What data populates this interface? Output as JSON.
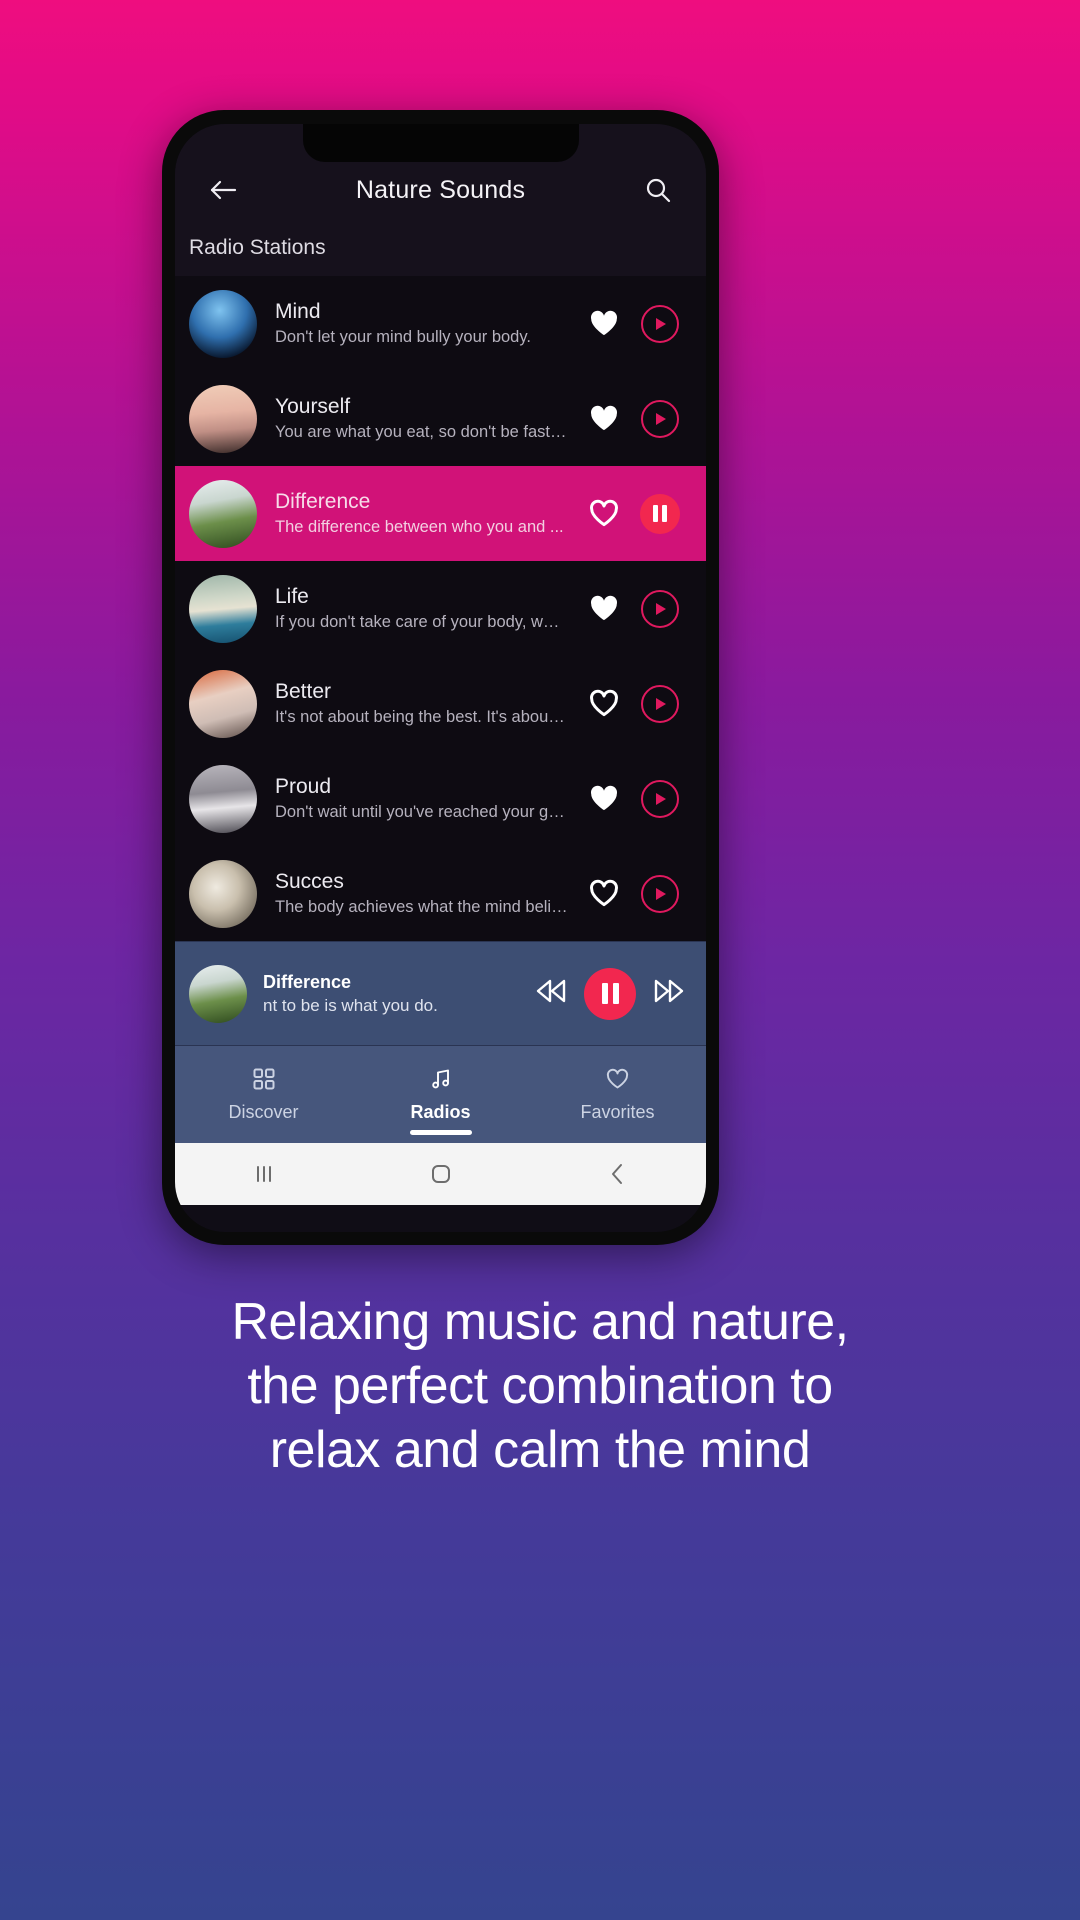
{
  "header": {
    "title": "Nature Sounds",
    "back_icon": "arrow-left-icon",
    "search_icon": "search-icon"
  },
  "section": {
    "label": "Radio Stations"
  },
  "stations": [
    {
      "title": "Mind",
      "subtitle": "Don't let your mind bully your body.",
      "art": "art-mind",
      "favorite": true,
      "playing": false
    },
    {
      "title": "Yourself",
      "subtitle": "You are what you eat, so don't be fast, c...",
      "art": "art-yourself",
      "favorite": true,
      "playing": false
    },
    {
      "title": "Difference",
      "subtitle": "The difference between who you and ...",
      "art": "art-difference",
      "favorite": false,
      "playing": true
    },
    {
      "title": "Life",
      "subtitle": "If you don't take care of your body, whe...",
      "art": "art-life",
      "favorite": true,
      "playing": false
    },
    {
      "title": "Better",
      "subtitle": "It's not about being the best. It's about ...",
      "art": "art-better",
      "favorite": false,
      "playing": false
    },
    {
      "title": "Proud",
      "subtitle": "Don't wait until you've reached your go...",
      "art": "art-proud",
      "favorite": true,
      "playing": false
    },
    {
      "title": "Succes",
      "subtitle": "The body achieves what the mind belie...",
      "art": "art-succes",
      "favorite": false,
      "playing": false
    }
  ],
  "mini_player": {
    "title": "Difference",
    "subtitle": "nt to be is what you do.",
    "art": "art-difference",
    "rewind_icon": "rewind-icon",
    "pause_icon": "pause-icon",
    "forward_icon": "fast-forward-icon"
  },
  "bottom_nav": {
    "items": [
      {
        "label": "Discover",
        "icon": "grid-icon",
        "active": false
      },
      {
        "label": "Radios",
        "icon": "music-note-icon",
        "active": true
      },
      {
        "label": "Favorites",
        "icon": "heart-outline-icon",
        "active": false
      }
    ]
  },
  "system_nav": {
    "recents_icon": "recents-icon",
    "home_icon": "home-icon",
    "back_icon": "back-chevron-icon"
  },
  "caption": {
    "lines": [
      "Relaxing music and nature,",
      "the perfect combination to",
      "relax and calm the mind"
    ]
  },
  "colors": {
    "accent_pink": "#d11278",
    "play_red": "#e0195f",
    "pause_red": "#f2274f",
    "player_blue": "#3d4e73",
    "nav_blue": "#46567c",
    "screen_bg": "#0e0b12"
  }
}
